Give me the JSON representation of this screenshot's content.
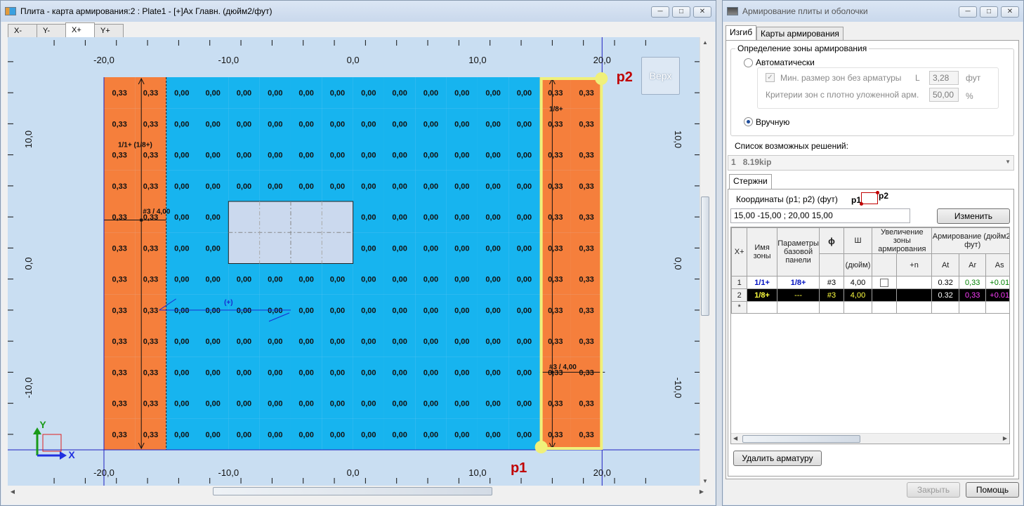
{
  "left_window": {
    "title": "Плита - карта армирования:2 : Plate1 - [+]Ax Главн. (дюйм2/фут)",
    "tabs": [
      "X-",
      "Y-",
      "X+",
      "Y+"
    ],
    "active_tab": "X+",
    "view_button": "Верх",
    "point_p1": "p1",
    "point_p2": "p2",
    "axis_x_label": "X",
    "axis_y_label": "Y",
    "x_ticks": [
      "-20,0",
      "-10,0",
      "0,0",
      "10,0",
      "20,0"
    ],
    "y_ticks_left": [
      "10,0",
      "0,0",
      "-10,0"
    ],
    "y_ticks_right": [
      "10,0",
      "0,0",
      "-10,0"
    ],
    "grid": {
      "rows": 12,
      "orange_value": "0,33",
      "blue_value": "0,00",
      "left_orange_cols": 2,
      "blue_cols": 12,
      "right_orange_cols": 2
    },
    "zone_labels": {
      "left_top": "1/1+ (1/8+)",
      "left_bar": "#3 / 4,00",
      "right_top": "1/8+",
      "right_bar": "#3 / 4,00",
      "plus_marker": "(+)"
    },
    "colors": {
      "orange": "#f57f3c",
      "blue": "#17b4ef",
      "hole": "#cbd9ee",
      "highlight": "#f0f07a",
      "point_label": "#c00000"
    }
  },
  "right_window": {
    "title": "Армирование плиты и оболочки",
    "tabs": [
      "Изгиб",
      "Карты армирования"
    ],
    "active_tab": "Изгиб",
    "group_title": "Определение зоны армирования",
    "radio_auto": "Автоматически",
    "radio_auto_selected": false,
    "check_min_size": "Мин. размер зон без арматуры",
    "check_min_size_checked": true,
    "min_size_letter": "L",
    "min_size_value": "3,28",
    "min_size_unit": "фут",
    "criteria_label": "Критерии зон с плотно уложенной арм.",
    "criteria_value": "50,00",
    "criteria_unit": "%",
    "radio_manual": "Вручную",
    "radio_manual_selected": true,
    "solutions_label": "Список возможных решений:",
    "solutions_selected_index": "1",
    "solutions_selected_value": "8.19kip",
    "bars_tab": "Стержни",
    "coords_label": "Координаты (p1; p2) (фут)",
    "coord_p1": "p1",
    "coord_p2": "p2",
    "coords_value": "15,00  -15,00  ;  20,00  15,00",
    "change_button": "Изменить",
    "table": {
      "corner": "X+",
      "col_zone_name": "Имя зоны",
      "col_params": "Параметры базовой панели",
      "col_phi": "ϕ",
      "col_spacing": "Ш",
      "col_spacing_unit": "(дюйм)",
      "col_increase": "Увеличение зоны армирования",
      "col_plus_n": "+n",
      "col_reinf": "Армирование (дюйм2/фут)",
      "col_at": "At",
      "col_ar": "Ar",
      "col_as": "As",
      "rows": [
        {
          "num": "1",
          "zone": "1/1+",
          "params": "1/8+",
          "phi": "#3",
          "spacing": "4,00",
          "n": "",
          "at": "0.32",
          "ar": "0,33",
          "as": "+0.01"
        },
        {
          "num": "2",
          "zone": "1/8+",
          "params": "---",
          "phi": "#3",
          "spacing": "4,00",
          "n": "",
          "at": "0.32",
          "ar": "0,33",
          "as": "+0.01"
        }
      ],
      "new_row_marker": "*"
    },
    "delete_button": "Удалить арматуру",
    "close_button": "Закрыть",
    "help_button": "Помощь"
  }
}
